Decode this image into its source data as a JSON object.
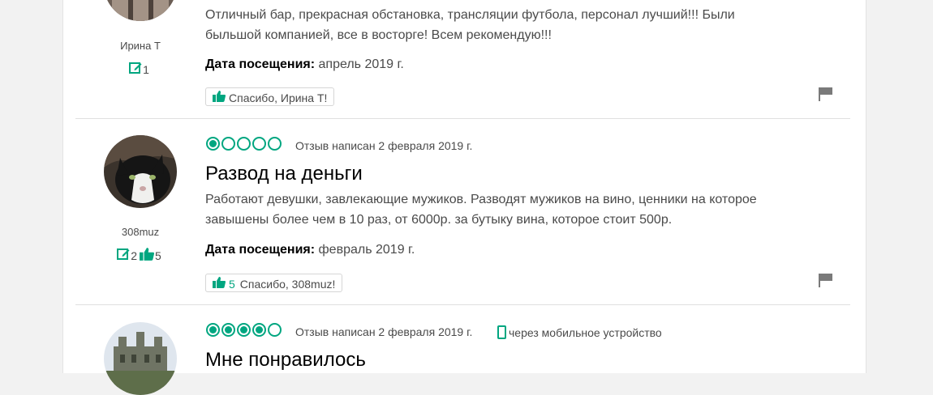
{
  "reviews": [
    {
      "username": "Ирина Т",
      "review_count": "1",
      "text": "Отличный бар, прекрасная обстановка, трансляции футбола, персонал лучший!!! Были быльшой компанией, все в восторге! Всем рекомендую!!!",
      "visit_label": "Дата посещения:",
      "visit_value": "апрель 2019 г.",
      "thanks_label": "Спасибо, Ирина Т!"
    },
    {
      "username": "308muz",
      "review_count": "2",
      "helpful_count": "5",
      "rating": 1,
      "date": "Отзыв написан 2 февраля 2019 г.",
      "title": "Развод на деньги",
      "text": "Работают девушки, завлекающие мужиков. Разводят мужиков на вино, ценники на которое завышены более чем в 10 раз, от 6000р. за бутыку вина, которое стоит 500р.",
      "visit_label": "Дата посещения:",
      "visit_value": "февраль 2019 г.",
      "thanks_count": "5",
      "thanks_label": "Спасибо, 308muz!"
    },
    {
      "rating": 4,
      "date": "Отзыв написан 2 февраля 2019 г.",
      "mobile": "через мобильное устройство",
      "title": "Мне понравилось"
    }
  ],
  "colors": {
    "accent": "#00a680",
    "flag": "#7a7a7a"
  },
  "icons": [
    "review-count-icon",
    "helpful-votes-icon",
    "thumbs-up-icon",
    "flag-icon",
    "mobile-phone-icon"
  ]
}
